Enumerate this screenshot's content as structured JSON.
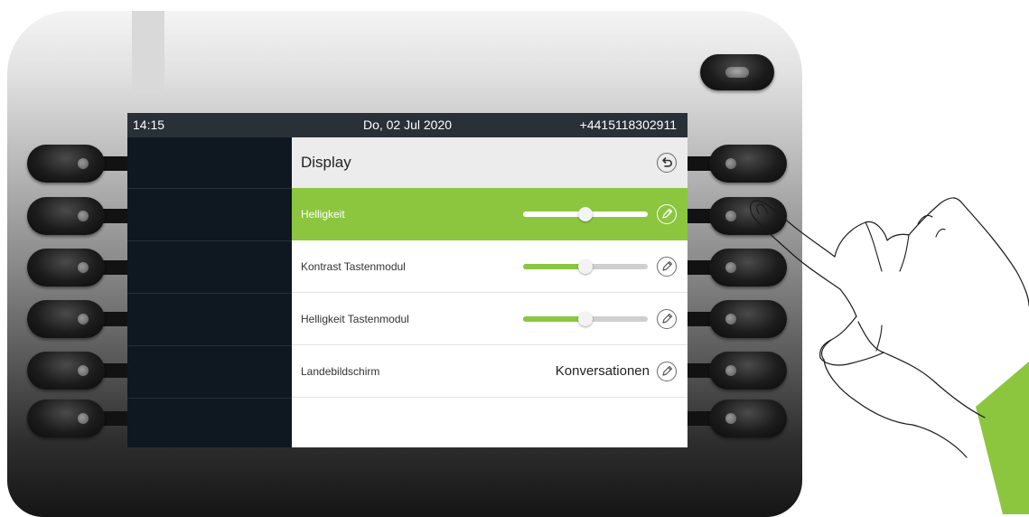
{
  "status_bar": {
    "time": "14:15",
    "date": "Do, 02 Jul 2020",
    "number": "+4415118302911"
  },
  "menu": {
    "title": "Display",
    "back_icon": "back-arrow-icon",
    "items": [
      {
        "label": "Helligkeit",
        "type": "slider",
        "level_percent": 50,
        "selected": true,
        "icon": "pencil-icon"
      },
      {
        "label": "Kontrast Tastenmodul",
        "type": "slider",
        "level_percent": 50,
        "selected": false,
        "icon": "pencil-icon"
      },
      {
        "label": "Helligkeit Tastenmodul",
        "type": "slider",
        "level_percent": 50,
        "selected": false,
        "icon": "pencil-icon"
      },
      {
        "label": "Landebildschirm",
        "type": "value",
        "value": "Konversationen",
        "selected": false,
        "icon": "pencil-icon"
      }
    ]
  },
  "colors": {
    "accent": "#8cc63f",
    "screen_background": "#0d141b",
    "status_bar": "#2a3038",
    "panel": "#ffffff"
  }
}
